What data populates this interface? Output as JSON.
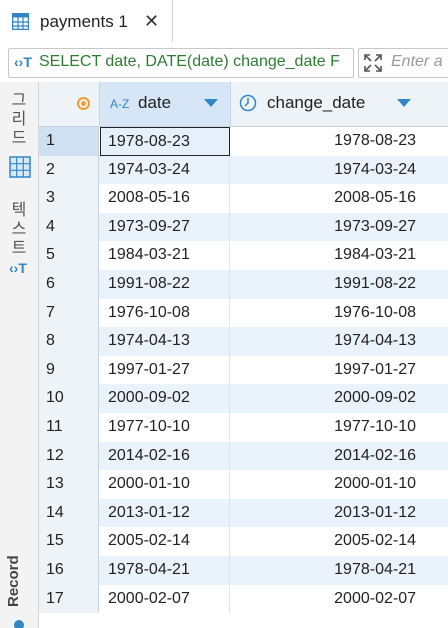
{
  "tab": {
    "label": "payments 1",
    "close": "✕",
    "icon": "table-icon"
  },
  "query": {
    "icon": "sql-icon",
    "icon_glyph": "‹›T",
    "text": "SELECT date, DATE(date) change_date F",
    "filter_placeholder": "Enter a"
  },
  "side_panel": {
    "grid_label": "그\n리\n드",
    "text_label": "텍\n스\n트",
    "record_label": "Record"
  },
  "columns": {
    "date": {
      "label": "date",
      "type_icon": "A-Z"
    },
    "change_date": {
      "label": "change_date"
    }
  },
  "rows": [
    {
      "n": "1",
      "date": "1978-08-23",
      "change_date": "1978-08-23"
    },
    {
      "n": "2",
      "date": "1974-03-24",
      "change_date": "1974-03-24"
    },
    {
      "n": "3",
      "date": "2008-05-16",
      "change_date": "2008-05-16"
    },
    {
      "n": "4",
      "date": "1973-09-27",
      "change_date": "1973-09-27"
    },
    {
      "n": "5",
      "date": "1984-03-21",
      "change_date": "1984-03-21"
    },
    {
      "n": "6",
      "date": "1991-08-22",
      "change_date": "1991-08-22"
    },
    {
      "n": "7",
      "date": "1976-10-08",
      "change_date": "1976-10-08"
    },
    {
      "n": "8",
      "date": "1974-04-13",
      "change_date": "1974-04-13"
    },
    {
      "n": "9",
      "date": "1997-01-27",
      "change_date": "1997-01-27"
    },
    {
      "n": "10",
      "date": "2000-09-02",
      "change_date": "2000-09-02"
    },
    {
      "n": "11",
      "date": "1977-10-10",
      "change_date": "1977-10-10"
    },
    {
      "n": "12",
      "date": "2014-02-16",
      "change_date": "2014-02-16"
    },
    {
      "n": "13",
      "date": "2000-01-10",
      "change_date": "2000-01-10"
    },
    {
      "n": "14",
      "date": "2013-01-12",
      "change_date": "2013-01-12"
    },
    {
      "n": "15",
      "date": "2005-02-14",
      "change_date": "2005-02-14"
    },
    {
      "n": "16",
      "date": "1978-04-21",
      "change_date": "1978-04-21"
    },
    {
      "n": "17",
      "date": "2000-02-07",
      "change_date": "2000-02-07"
    }
  ],
  "colors": {
    "accent": "#2f86c9",
    "query_text": "#2e7d32",
    "row_alt": "#eaf3fb"
  }
}
